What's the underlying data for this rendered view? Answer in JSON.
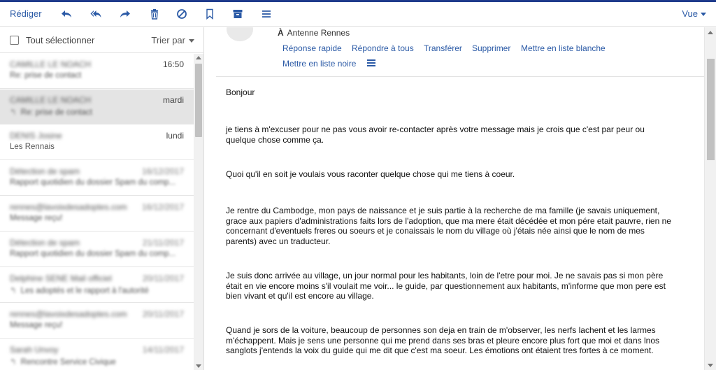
{
  "toolbar": {
    "compose_label": "Rédiger",
    "view_label": "Vue",
    "icons": [
      "reply-icon",
      "reply-all-icon",
      "forward-icon",
      "trash-icon",
      "block-icon",
      "bookmark-icon",
      "archive-icon",
      "menu-icon"
    ]
  },
  "list": {
    "select_all_label": "Tout sélectionner",
    "sort_label": "Trier par",
    "messages": [
      {
        "from": "CAMILLE LE NOACH",
        "date": "16:50",
        "subject": "Re: prise de contact",
        "replied": false,
        "selected": false,
        "from_blurred": true,
        "date_blurred": false,
        "subject_blurred": true
      },
      {
        "from": "CAMILLE LE NOACH",
        "date": "mardi",
        "subject": "Re: prise de contact",
        "replied": true,
        "selected": true,
        "from_blurred": true,
        "date_blurred": false,
        "subject_blurred": true
      },
      {
        "from": "DENIS Josine",
        "date": "lundi",
        "subject": "Les Rennais",
        "replied": false,
        "selected": false,
        "from_blurred": true,
        "date_blurred": false,
        "subject_blurred": false
      },
      {
        "from": "Détection de spam",
        "date": "16/12/2017",
        "subject": "Rapport quotidien du dossier Spam du comp...",
        "replied": false,
        "selected": false,
        "from_blurred": true,
        "date_blurred": true,
        "subject_blurred": true
      },
      {
        "from": "rennes@lavoixdesadoptes.com",
        "date": "16/12/2017",
        "subject": "Message reçu!",
        "replied": false,
        "selected": false,
        "from_blurred": true,
        "date_blurred": true,
        "subject_blurred": true
      },
      {
        "from": "Détection de spam",
        "date": "21/11/2017",
        "subject": "Rapport quotidien du dossier Spam du comp...",
        "replied": false,
        "selected": false,
        "from_blurred": true,
        "date_blurred": true,
        "subject_blurred": true
      },
      {
        "from": "Delphine SENE Mail officiel",
        "date": "20/11/2017",
        "subject": "Les adoptés et le rapport à l'autorité",
        "replied": true,
        "selected": false,
        "from_blurred": true,
        "date_blurred": true,
        "subject_blurred": true
      },
      {
        "from": "rennes@lavoixdesadoptes.com",
        "date": "20/11/2017",
        "subject": "Message reçu!",
        "replied": false,
        "selected": false,
        "from_blurred": true,
        "date_blurred": true,
        "subject_blurred": true
      },
      {
        "from": "Sarah Unvoy",
        "date": "14/11/2017",
        "subject": "Rencontre Service Civique",
        "replied": true,
        "selected": false,
        "from_blurred": true,
        "date_blurred": true,
        "subject_blurred": true
      }
    ]
  },
  "reading": {
    "to_prefix": "À",
    "to_name": "Antenne Rennes",
    "actions": [
      "Réponse rapide",
      "Répondre à tous",
      "Transférer",
      "Supprimer",
      "Mettre en liste blanche",
      "Mettre en liste noire"
    ],
    "paragraphs": [
      "Bonjour",
      "je tiens à m'excuser pour ne pas vous avoir  re-contacter après votre message mais je crois que c'est par peur ou quelque chose comme ça.",
      "Quoi qu'il en soit je voulais vous raconter quelque chose qui me tiens à coeur.",
      "Je rentre du Cambodge, mon pays de naissance et je suis partie à la recherche de ma famille (je savais uniquement, grace aux papiers d'administrations faits lors de l'adoption, que ma mere était décédée et mon pére etait pauvre, rien ne concernant d'eventuels freres ou soeurs et je conaissais le nom du village où j'étais née ainsi que le nom de mes parents) avec un traducteur.",
      "Je suis donc arrivée au village, un jour normal pour les habitants, loin de l'etre pour moi. Je ne savais pas si mon père était en vie encore moins s'il voulait me voir... le guide, par questionnement aux habitants, m'informe que mon pere est bien vivant et qu'il est encore au village.",
      "Quand je sors de la voiture, beaucoup de personnes son deja en train de m'observer, les nerfs lachent et les larmes m'échappent. Mais je sens une personne qui me prend dans ses bras et pleure encore plus fort que moi et dans lnos sanglots j'entends la voix du guide qui me dit que c'est ma soeur. Les émotions ont étaient tres fortes à ce moment."
    ]
  },
  "colors": {
    "accent": "#2b5aa6",
    "top_bar": "#1f3b8c",
    "selected_row": "#e4e4e4"
  }
}
